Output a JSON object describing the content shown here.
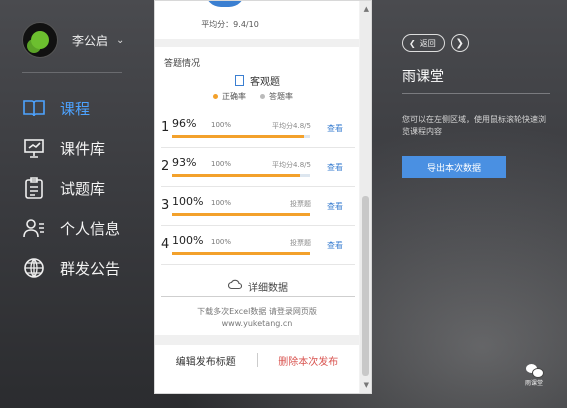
{
  "user": {
    "name": "李公启",
    "menu_icon": "chevron-down-icon"
  },
  "nav": [
    {
      "label": "课程",
      "icon": "book-icon",
      "active": true
    },
    {
      "label": "课件库",
      "icon": "presentation-icon",
      "active": false
    },
    {
      "label": "试题库",
      "icon": "clipboard-icon",
      "active": false
    },
    {
      "label": "个人信息",
      "icon": "person-icon",
      "active": false
    },
    {
      "label": "群发公告",
      "icon": "globe-icon",
      "active": false
    }
  ],
  "panel": {
    "avg_score_top": "平均分：9.4/10",
    "section_title": "答题情况",
    "tab_label": "客观题",
    "legend": {
      "correct": "正确率",
      "answer": "答题率"
    },
    "rows": [
      {
        "num": "1",
        "rate": "96%",
        "pct": "100%",
        "score": "平均分4.8/5",
        "link": "查看",
        "fill": 0.96
      },
      {
        "num": "2",
        "rate": "93%",
        "pct": "100%",
        "score": "平均分4.8/5",
        "link": "查看",
        "fill": 0.93
      },
      {
        "num": "3",
        "rate": "100%",
        "pct": "100%",
        "score": "投票题",
        "link": "查看",
        "fill": 1.0
      },
      {
        "num": "4",
        "rate": "100%",
        "pct": "100%",
        "score": "投票题",
        "link": "查看",
        "fill": 1.0
      }
    ],
    "detail_label": "详细数据",
    "hint_line1": "下载多次Excel数据 请登录网页版",
    "hint_line2": "www.yuketang.cn",
    "edit_label": "编辑发布标题",
    "delete_label": "删除本次发布"
  },
  "right": {
    "back_label": "返回",
    "title": "雨课堂",
    "description": "您可以在左侧区域，使用鼠标滚轮快速浏览课程内容",
    "export_label": "导出本次数据",
    "wechat_caption": "雨课堂"
  },
  "colors": {
    "accent_blue": "#4a90e2",
    "bar_orange": "#f3a12b",
    "active_nav": "#4da3ff",
    "delete_red": "#d9534f"
  }
}
